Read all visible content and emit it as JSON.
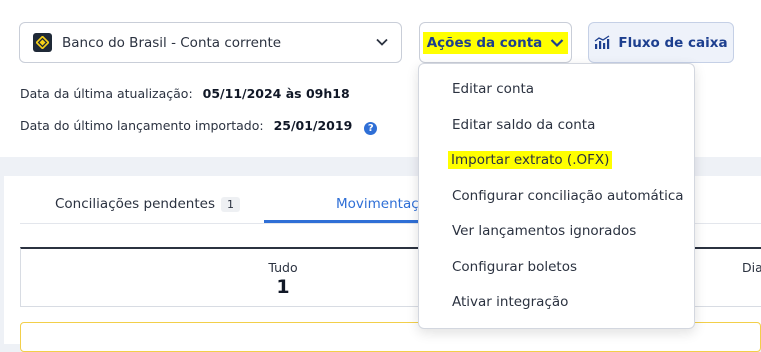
{
  "account": {
    "selected": "Banco do Brasil - Conta corrente",
    "logo_icon": "banco-do-brasil-logo",
    "chevron_icon": "chevron-down-icon"
  },
  "actions": {
    "label": "Ações da conta",
    "highlight_color": "#ffff00"
  },
  "cashflow": {
    "label": "Fluxo de caixa",
    "icon": "bar-chart-icon"
  },
  "info": {
    "last_update_label": "Data da última atualização:",
    "last_update_value": "05/11/2024 às 09h18",
    "last_import_label": "Data do último lançamento importado:",
    "last_import_value": "25/01/2019",
    "help_icon": "?"
  },
  "tabs": {
    "pending_label": "Conciliações pendentes",
    "pending_count": "1",
    "movements_label": "Movimentaç"
  },
  "summary": {
    "all_label": "Tudo",
    "all_value": "1",
    "right_label": "Dia"
  },
  "menu": {
    "items": [
      "Editar conta",
      "Editar saldo da conta",
      "Importar extrato (.OFX)",
      "Configurar conciliação automática",
      "Ver lançamentos ignorados",
      "Configurar boletos",
      "Ativar integração"
    ]
  },
  "colors": {
    "accent": "#2f6fd6",
    "brand_dark": "#1d3f8f",
    "highlight": "#ffff00"
  }
}
